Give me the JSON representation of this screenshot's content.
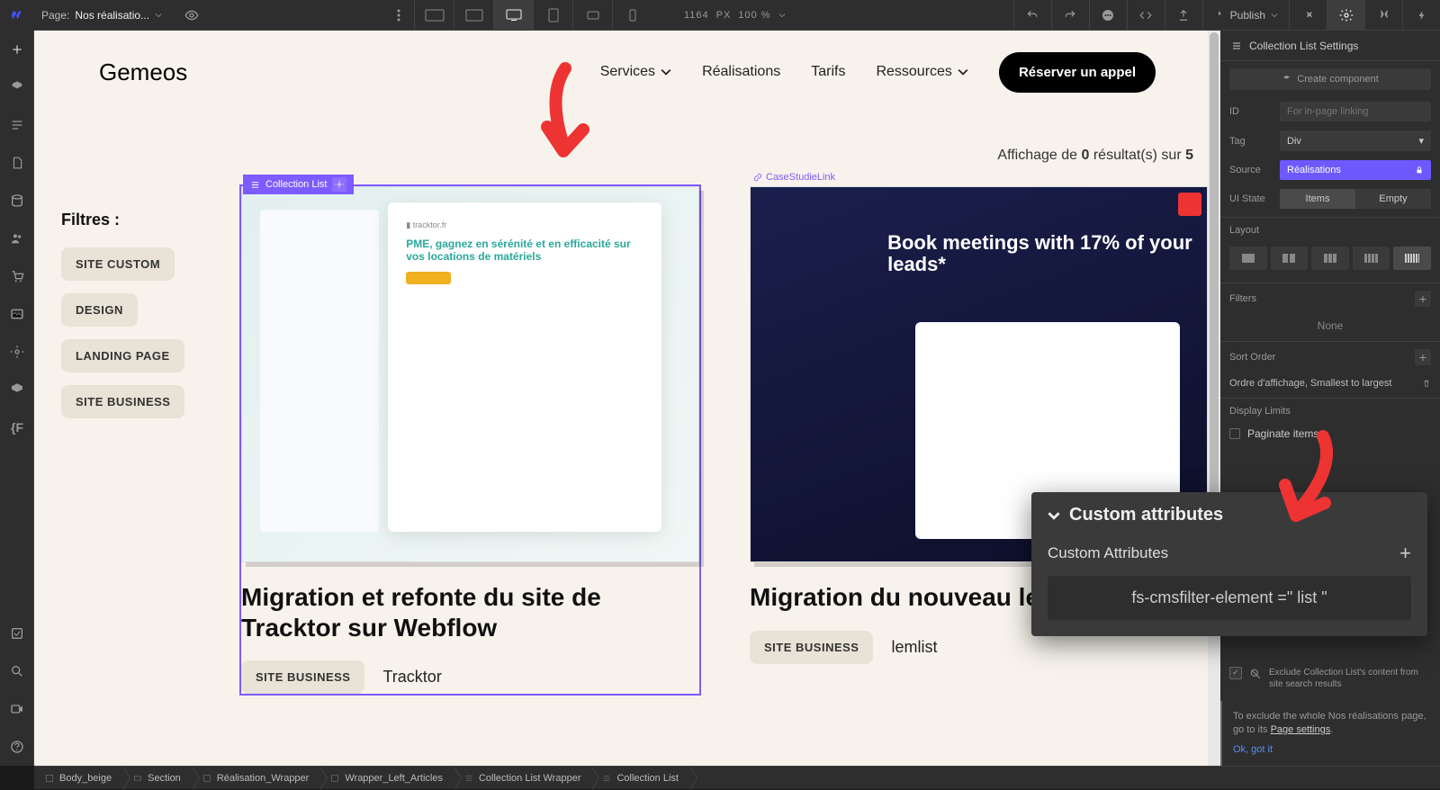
{
  "topbar": {
    "page_label": "Page:",
    "page_name": "Nos réalisatio...",
    "canvas_width": "1164",
    "canvas_unit": "PX",
    "zoom": "100 %",
    "publish": "Publish"
  },
  "site": {
    "logo": "Gemeos",
    "menu": [
      "Services",
      "Réalisations",
      "Tarifs",
      "Ressources"
    ],
    "cta": "Réserver un appel",
    "results_prefix": "Affichage de ",
    "results_count": "0",
    "results_mid": " résultat(s) sur ",
    "results_total": "5"
  },
  "filters": {
    "title": "Filtres :",
    "items": [
      "SITE CUSTOM",
      "DESIGN",
      "LANDING PAGE",
      "SITE BUSINESS"
    ]
  },
  "collection_badge": "Collection List",
  "case_link": "CaseStudieLink",
  "cards": [
    {
      "title": "Migration et refonte du site de Tracktor sur Webflow",
      "tag": "SITE BUSINESS",
      "client": "Tracktor",
      "thumb_h1a": "PME, gagnez en ",
      "thumb_h1b": "sérénité",
      "thumb_h1c": " et en ",
      "thumb_h1d": "efficacité",
      "thumb_h1e": " sur vos locations de matériels"
    },
    {
      "title": "Migration du nouveau lemlist",
      "tag": "SITE BUSINESS",
      "client": "lemlist",
      "thumb_h1": "Book meetings with 17% of your leads*"
    }
  ],
  "panel": {
    "title": "Collection List Settings",
    "create": "Create component",
    "id_label": "ID",
    "id_placeholder": "For in-page linking",
    "tag_label": "Tag",
    "tag_value": "Div",
    "source_label": "Source",
    "source_value": "Réalisations",
    "uistate_label": "UI State",
    "uistate_items": "Items",
    "uistate_empty": "Empty",
    "layout": "Layout",
    "filters": "Filters",
    "none": "None",
    "sort": "Sort Order",
    "sort_value": "Ordre d'affichage, Smallest to largest",
    "display_limits": "Display Limits",
    "paginate": "Paginate items",
    "exclude": "Exclude Collection List's content from site search results",
    "tip": "To exclude the whole Nos réalisations page, go to its ",
    "tip_link": "Page settings",
    "tip_ok": "Ok, got it"
  },
  "popup": {
    "title": "Custom attributes",
    "subtitle": "Custom Attributes",
    "attr": "fs-cmsfilter-element =\" list \""
  },
  "breadcrumbs": [
    "Body_beige",
    "Section",
    "Réalisation_Wrapper",
    "Wrapper_Left_Articles",
    "Collection List Wrapper",
    "Collection List"
  ]
}
